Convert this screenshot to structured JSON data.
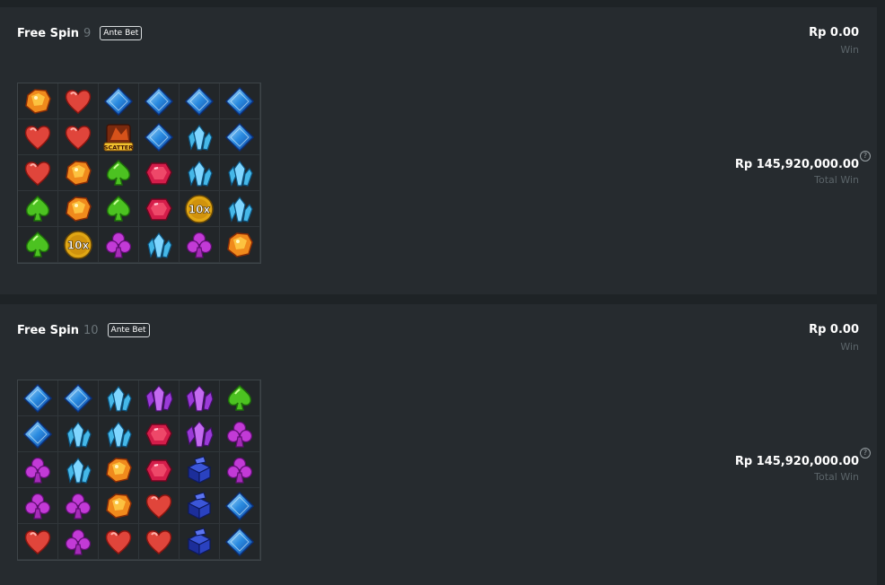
{
  "colors": {
    "background": "#1e2326",
    "panel": "#262b2f",
    "muted": "#5b6469"
  },
  "spins": [
    {
      "title": "Free Spin",
      "number": "9",
      "badge": "Ante Bet",
      "win_value": "Rp 0.00",
      "win_label": "Win",
      "total_win_value": "Rp 145,920,000.00",
      "total_win_label": "Total Win",
      "grid": [
        [
          "amber-gem",
          "red-heart",
          "blue-diamond",
          "blue-diamond",
          "blue-diamond",
          "blue-diamond"
        ],
        [
          "red-heart",
          "red-heart",
          "scatter",
          "blue-diamond",
          "cyan-crystal",
          "blue-diamond"
        ],
        [
          "red-heart",
          "amber-gem",
          "green-spade",
          "ruby-gem",
          "cyan-crystal",
          "cyan-crystal"
        ],
        [
          "green-spade",
          "amber-gem",
          "green-spade",
          "ruby-gem",
          "multiplier",
          "cyan-crystal"
        ],
        [
          "green-spade",
          "multiplier",
          "purple-club",
          "cyan-crystal",
          "purple-club",
          "amber-gem"
        ]
      ],
      "labels": [
        [
          "",
          "",
          "",
          "",
          "",
          ""
        ],
        [
          "",
          "",
          "SCATTER",
          "",
          "",
          ""
        ],
        [
          "",
          "",
          "",
          "",
          "",
          ""
        ],
        [
          "",
          "",
          "",
          "",
          "10x",
          ""
        ],
        [
          "",
          "10x",
          "",
          "",
          "",
          ""
        ]
      ]
    },
    {
      "title": "Free Spin",
      "number": "10",
      "badge": "Ante Bet",
      "win_value": "Rp 0.00",
      "win_label": "Win",
      "total_win_value": "Rp 145,920,000.00",
      "total_win_label": "Total Win",
      "grid": [
        [
          "blue-diamond",
          "blue-diamond",
          "cyan-crystal",
          "purple-crystal",
          "purple-crystal",
          "green-spade"
        ],
        [
          "blue-diamond",
          "cyan-crystal",
          "cyan-crystal",
          "ruby-gem",
          "purple-crystal",
          "purple-club"
        ],
        [
          "purple-club",
          "cyan-crystal",
          "amber-gem",
          "ruby-gem",
          "navy-block",
          "purple-club"
        ],
        [
          "purple-club",
          "purple-club",
          "amber-gem",
          "red-heart",
          "navy-block",
          "blue-diamond"
        ],
        [
          "red-heart",
          "purple-club",
          "red-heart",
          "red-heart",
          "navy-block",
          "blue-diamond"
        ]
      ],
      "labels": [
        [
          "",
          "",
          "",
          "",
          "",
          ""
        ],
        [
          "",
          "",
          "",
          "",
          "",
          ""
        ],
        [
          "",
          "",
          "",
          "",
          "",
          ""
        ],
        [
          "",
          "",
          "",
          "",
          "",
          ""
        ],
        [
          "",
          "",
          "",
          "",
          "",
          ""
        ]
      ]
    }
  ]
}
